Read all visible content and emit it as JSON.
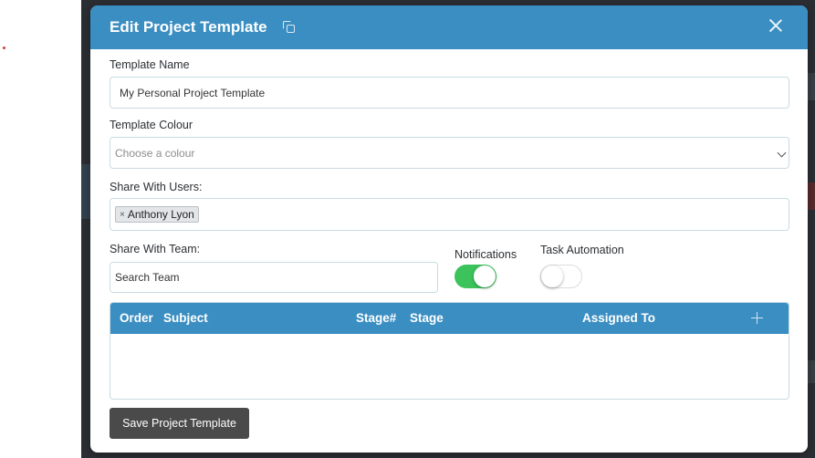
{
  "modal": {
    "title": "Edit Project Template",
    "icons": {
      "copy": "copy-icon",
      "close": "close-icon"
    }
  },
  "form": {
    "template_name_label": "Template Name",
    "template_name_value": "My Personal Project Template",
    "template_colour_label": "Template Colour",
    "template_colour_placeholder": "Choose a colour",
    "share_users_label": "Share With Users:",
    "share_users_tags": [
      "Anthony Lyon"
    ],
    "share_team_label": "Share With Team:",
    "share_team_value": "Search Team",
    "notifications_label": "Notifications",
    "notifications_on": true,
    "task_automation_label": "Task Automation",
    "task_automation_on": false
  },
  "table": {
    "columns": [
      "Order",
      "Subject",
      "Stage#",
      "Stage",
      "Assigned To"
    ],
    "add_icon": "plus-icon",
    "rows": []
  },
  "actions": {
    "save_label": "Save Project Template"
  },
  "colors": {
    "header": "#3b8ec2",
    "toggle_on": "#3cc35b",
    "save_button": "#4a4a4a",
    "backdrop": "#2b2f33"
  }
}
